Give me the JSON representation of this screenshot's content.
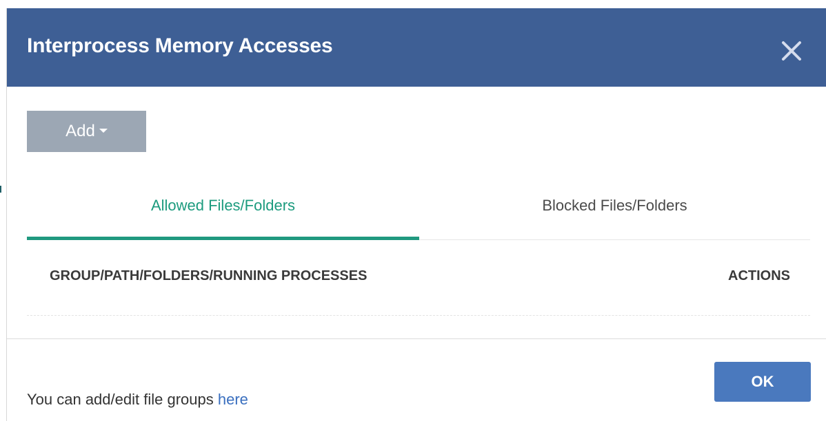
{
  "dialog": {
    "title": "Interprocess Memory Accesses",
    "close_icon": "close-icon"
  },
  "toolbar": {
    "add_label": "Add",
    "add_caret_icon": "caret-down-icon"
  },
  "tabs": [
    {
      "label": "Allowed Files/Folders",
      "active": true
    },
    {
      "label": "Blocked Files/Folders",
      "active": false
    }
  ],
  "table": {
    "columns": [
      "GROUP/PATH/FOLDERS/RUNNING PROCESSES",
      "ACTIONS"
    ],
    "rows": []
  },
  "footer": {
    "text": "You can add/edit file groups",
    "link_text": "here",
    "ok_label": "OK"
  },
  "colors": {
    "header_bg": "#3e5f95",
    "accent_green": "#20997f",
    "ok_button": "#4a79be",
    "add_button": "#9ca7b4",
    "link": "#3a6fbf"
  }
}
